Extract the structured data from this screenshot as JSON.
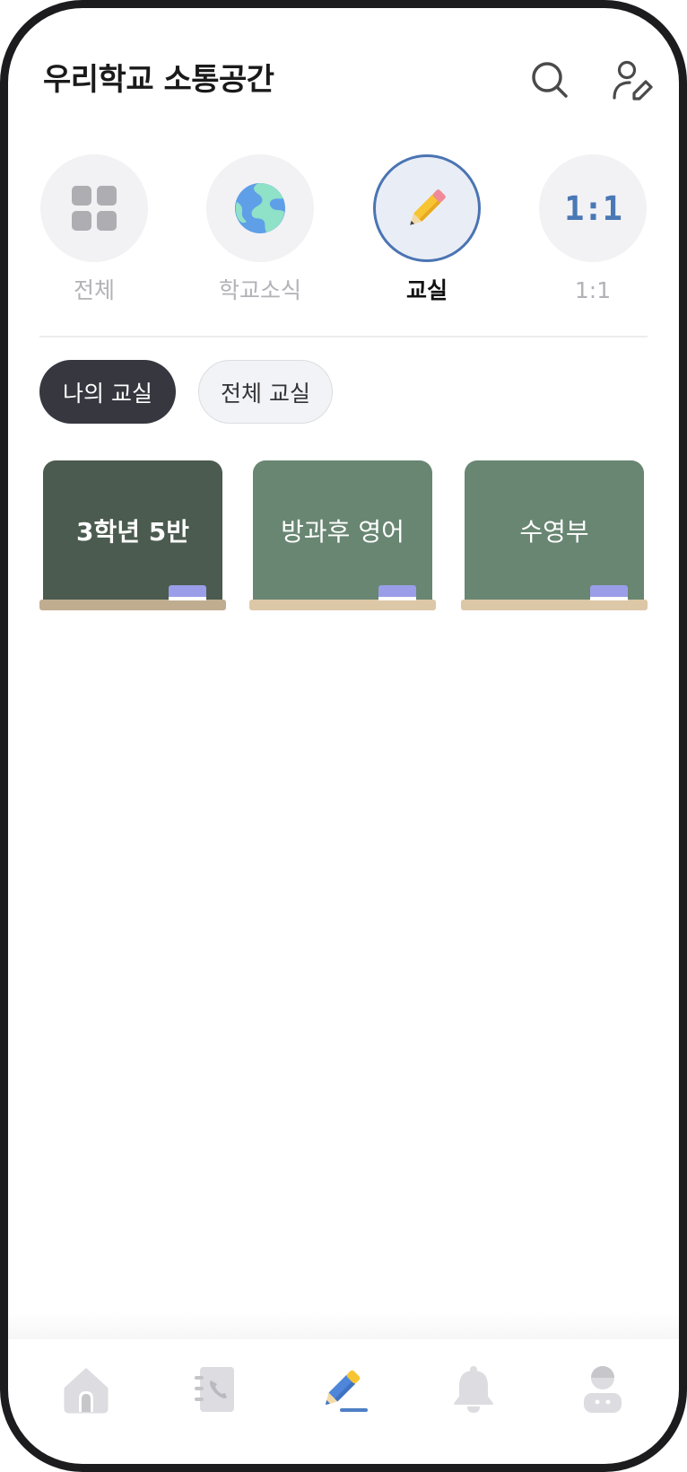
{
  "header": {
    "title": "우리학교 소통공간",
    "search_icon": "search-icon",
    "profile_icon": "profile-edit-icon"
  },
  "categories": [
    {
      "label": "전체",
      "icon": "grid-icon",
      "selected": false
    },
    {
      "label": "학교소식",
      "icon": "globe-icon",
      "selected": false
    },
    {
      "label": "교실",
      "icon": "pencil-icon",
      "selected": true
    },
    {
      "label": "1:1",
      "icon_text": "1:1",
      "selected": false
    }
  ],
  "filters": [
    {
      "label": "나의 교실",
      "active": true
    },
    {
      "label": "전체 교실",
      "active": false
    }
  ],
  "classrooms": [
    {
      "name": "3학년 5반",
      "highlighted": true
    },
    {
      "name": "방과후 영어",
      "highlighted": false
    },
    {
      "name": "수영부",
      "highlighted": false
    }
  ],
  "bottom_nav": [
    {
      "icon": "home-icon",
      "active": false
    },
    {
      "icon": "contacts-book-icon",
      "active": false
    },
    {
      "icon": "pencil-icon",
      "active": true
    },
    {
      "icon": "bell-icon",
      "active": false
    },
    {
      "icon": "user-icon",
      "active": false
    }
  ],
  "colors": {
    "accent": "#4b74b3",
    "pill_dark": "#36373f",
    "board_dark": "#4b5b4f",
    "board": "#688672",
    "ledge_dark": "#c0ad90",
    "ledge": "#dcc7a6",
    "eraser": "#9a9ee8",
    "nav_icon": "#dcdce1",
    "nav_active": "#4f86d9"
  }
}
